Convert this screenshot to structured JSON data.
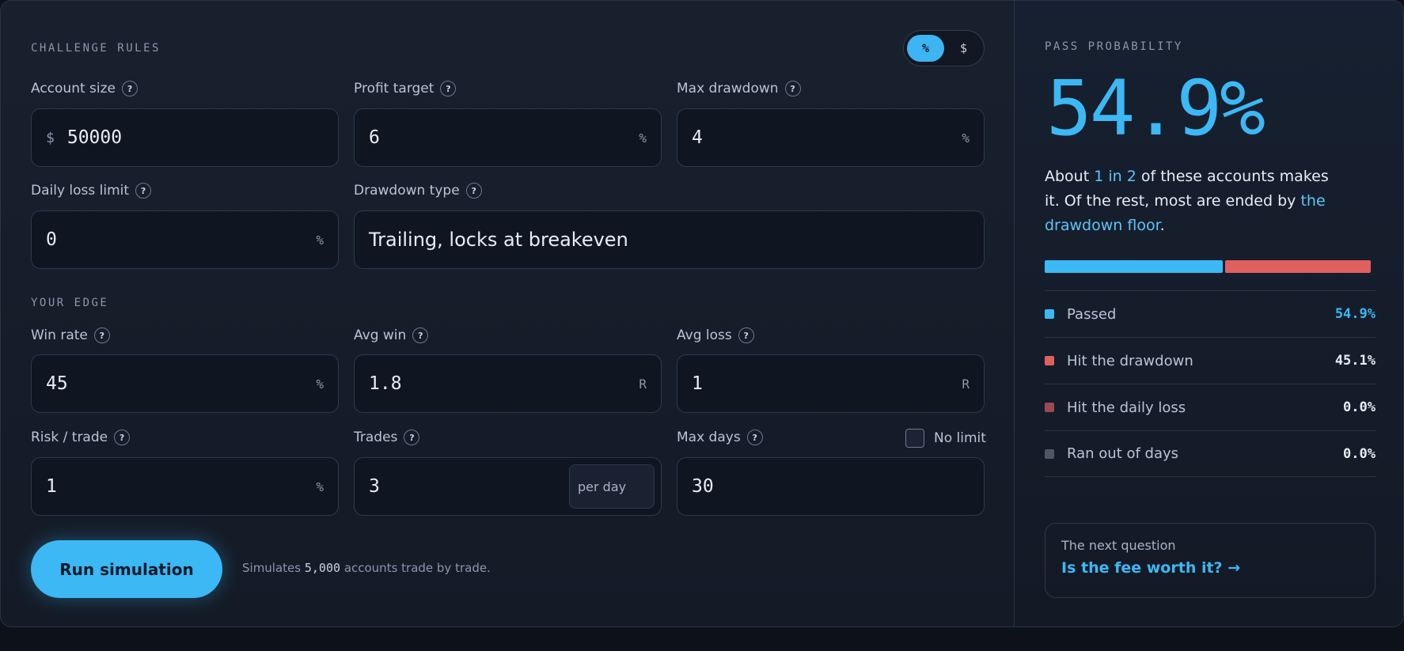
{
  "challenge_rules": {
    "title": "CHALLENGE RULES",
    "unit_toggle": {
      "percent": "%",
      "dollar": "$",
      "selected": "%"
    },
    "account_size": {
      "label": "Account size",
      "prefix": "$",
      "value": "50000"
    },
    "profit_target": {
      "label": "Profit target",
      "value": "6",
      "suffix": "%"
    },
    "max_drawdown": {
      "label": "Max drawdown",
      "value": "4",
      "suffix": "%"
    },
    "daily_loss_limit": {
      "label": "Daily loss limit",
      "value": "0",
      "suffix": "%"
    },
    "drawdown_type": {
      "label": "Drawdown type",
      "value": "Trailing, locks at breakeven"
    }
  },
  "your_edge": {
    "title": "YOUR EDGE",
    "win_rate": {
      "label": "Win rate",
      "value": "45",
      "suffix": "%"
    },
    "avg_win": {
      "label": "Avg win",
      "value": "1.8",
      "suffix": "R"
    },
    "avg_loss": {
      "label": "Avg loss",
      "value": "1",
      "suffix": "R"
    },
    "risk_per_trade": {
      "label": "Risk / trade",
      "value": "1",
      "suffix": "%"
    },
    "trades": {
      "label": "Trades",
      "value": "3",
      "unit": "per day"
    },
    "max_days": {
      "label": "Max days",
      "value": "30",
      "no_limit_label": "No limit",
      "no_limit_checked": false
    }
  },
  "help_glyph": "?",
  "run": {
    "button_label": "Run simulation",
    "note_prefix": "Simulates",
    "note_count": "5,000",
    "note_suffix": "accounts trade by trade."
  },
  "results": {
    "title": "PASS PROBABILITY",
    "pass_probability": "54.9%",
    "summary": {
      "t1": "About",
      "h1": "1 in 2",
      "t2": "of these accounts makes it. Of the rest, most are ended by",
      "h2": "the drawdown floor",
      "t3": "."
    },
    "bar": [
      {
        "fraction": 0.549,
        "color": "#3cb8f4"
      },
      {
        "fraction": 0.451,
        "color": "#e0605f"
      }
    ],
    "outcomes": [
      {
        "name": "Passed",
        "pct": "54.9%",
        "color": "#3cb8f4",
        "pct_color": "#3cb8f4"
      },
      {
        "name": "Hit the drawdown",
        "pct": "45.1%",
        "color": "#e0605f",
        "pct_color": "#e8edf5"
      },
      {
        "name": "Hit the daily loss",
        "pct": "0.0%",
        "color": "#9a4a52",
        "pct_color": "#e8edf5"
      },
      {
        "name": "Ran out of days",
        "pct": "0.0%",
        "color": "#4e5766",
        "pct_color": "#e8edf5"
      }
    ],
    "next": {
      "question": "The next question",
      "link": "Is the fee worth it? →"
    }
  }
}
